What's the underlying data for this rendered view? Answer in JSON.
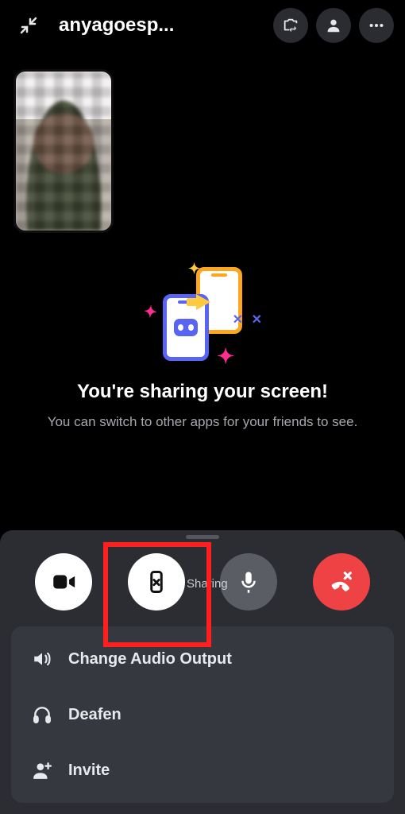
{
  "header": {
    "title": "anyagoesp..."
  },
  "center": {
    "heading": "You're sharing your screen!",
    "subtext": "You can switch to other apps for your friends to see."
  },
  "controls": {
    "stop_share_hint": "Sharing"
  },
  "menu": {
    "items": [
      {
        "label": "Change Audio Output"
      },
      {
        "label": "Deafen"
      },
      {
        "label": "Invite"
      }
    ]
  },
  "colors": {
    "danger": "#ee4245",
    "highlight": "#ff1f1f",
    "accent": "#5865f2"
  }
}
